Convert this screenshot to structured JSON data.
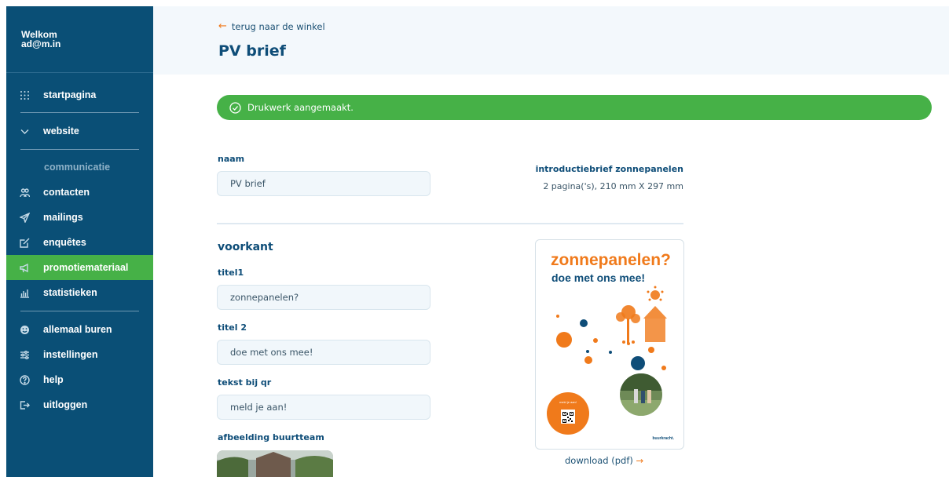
{
  "sidebar": {
    "welcome_line1": "Welkom",
    "welcome_line2": "ad@m.in",
    "items": {
      "home": {
        "label": "startpagina",
        "icon": "grid-dots-icon"
      },
      "website": {
        "label": "website",
        "icon": "chevron-down-icon"
      },
      "section": "communicatie",
      "contacts": {
        "label": "contacten",
        "icon": "users-icon"
      },
      "mailings": {
        "label": "mailings",
        "icon": "paper-plane-icon"
      },
      "surveys": {
        "label": "enquêtes",
        "icon": "edit-box-icon"
      },
      "promo": {
        "label": "promotiemateriaal",
        "icon": "megaphone-icon"
      },
      "stats": {
        "label": "statistieken",
        "icon": "bar-chart-icon"
      },
      "neighbors": {
        "label": "allemaal buren",
        "icon": "smiley-icon"
      },
      "settings": {
        "label": "instellingen",
        "icon": "sliders-icon"
      },
      "help": {
        "label": "help",
        "icon": "question-icon"
      },
      "logout": {
        "label": "uitloggen",
        "icon": "logout-icon"
      }
    },
    "colors": {
      "background": "#0a4f76",
      "active": "#46b147"
    }
  },
  "header": {
    "back_label": "terug naar de winkel",
    "title": "PV brief"
  },
  "alert": {
    "message": "Drukwerk aangemaakt.",
    "color": "#46b147"
  },
  "form": {
    "name_label": "naam",
    "name_value": "PV brief",
    "front_title": "voorkant",
    "title1_label": "titel1",
    "title1_value": "zonnepanelen?",
    "title2_label": "titel 2",
    "title2_value": "doe met ons mee!",
    "qr_label": "tekst bij qr",
    "qr_value": "meld je aan!",
    "image_label": "afbeelding buurtteam"
  },
  "product": {
    "title": "introductiebrief zonnepanelen",
    "details": "2 pagina('s), 210 mm X 297 mm"
  },
  "preview": {
    "title1": "zonnepanelen?",
    "title2": "doe met ons mee!",
    "qr_text": "meld je aan!",
    "brand": "buurkracht."
  },
  "download": {
    "label": "download (pdf)",
    "arrow": "→"
  }
}
